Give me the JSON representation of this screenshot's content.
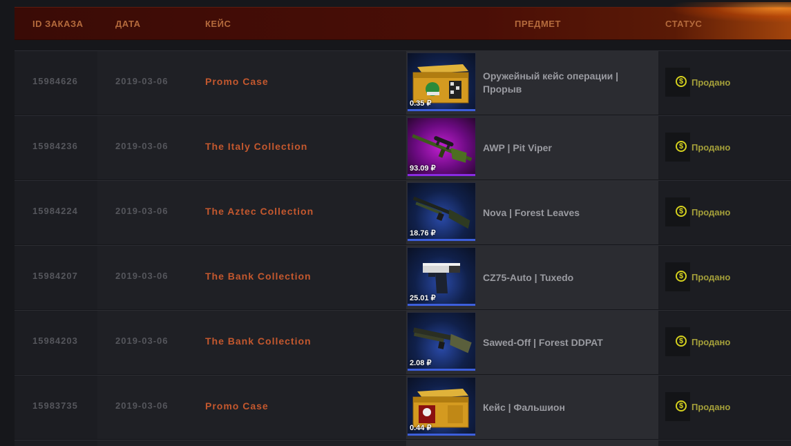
{
  "headers": {
    "id": "ID ЗАКАЗА",
    "date": "ДАТА",
    "case": "КЕЙС",
    "item": "ПРЕДМЕТ",
    "status": "СТАТУС"
  },
  "colors": {
    "case_link": "#c4582e",
    "status": "#d6d21e",
    "header_bg": "#4a0e06"
  },
  "rows": [
    {
      "id": "15984626",
      "date": "2019-03-06",
      "case": "Promo Case",
      "item_line1": "Оружейный кейс операции |",
      "item_line2": "Прорыв",
      "price": "0.35 ₽",
      "status": "Продано",
      "thumb": "case-box-icon"
    },
    {
      "id": "15984236",
      "date": "2019-03-06",
      "case": "The Italy Collection",
      "item_line1": "AWP | Pit Viper",
      "item_line2": "",
      "price": "93.09 ₽",
      "status": "Продано",
      "thumb": "sniper-rifle-icon"
    },
    {
      "id": "15984224",
      "date": "2019-03-06",
      "case": "The Aztec Collection",
      "item_line1": "Nova | Forest Leaves",
      "item_line2": "",
      "price": "18.76 ₽",
      "status": "Продано",
      "thumb": "shotgun-icon"
    },
    {
      "id": "15984207",
      "date": "2019-03-06",
      "case": "The Bank Collection",
      "item_line1": "CZ75-Auto | Tuxedo",
      "item_line2": "",
      "price": "25.01 ₽",
      "status": "Продано",
      "thumb": "pistol-icon"
    },
    {
      "id": "15984203",
      "date": "2019-03-06",
      "case": "The Bank Collection",
      "item_line1": "Sawed-Off | Forest DDPAT",
      "item_line2": "",
      "price": "2.08 ₽",
      "status": "Продано",
      "thumb": "shotgun-icon"
    },
    {
      "id": "15983735",
      "date": "2019-03-06",
      "case": "Promo Case",
      "item_line1": "Кейс | Фальшион",
      "item_line2": "",
      "price": "0.44 ₽",
      "status": "Продано",
      "thumb": "case-box-icon"
    }
  ]
}
